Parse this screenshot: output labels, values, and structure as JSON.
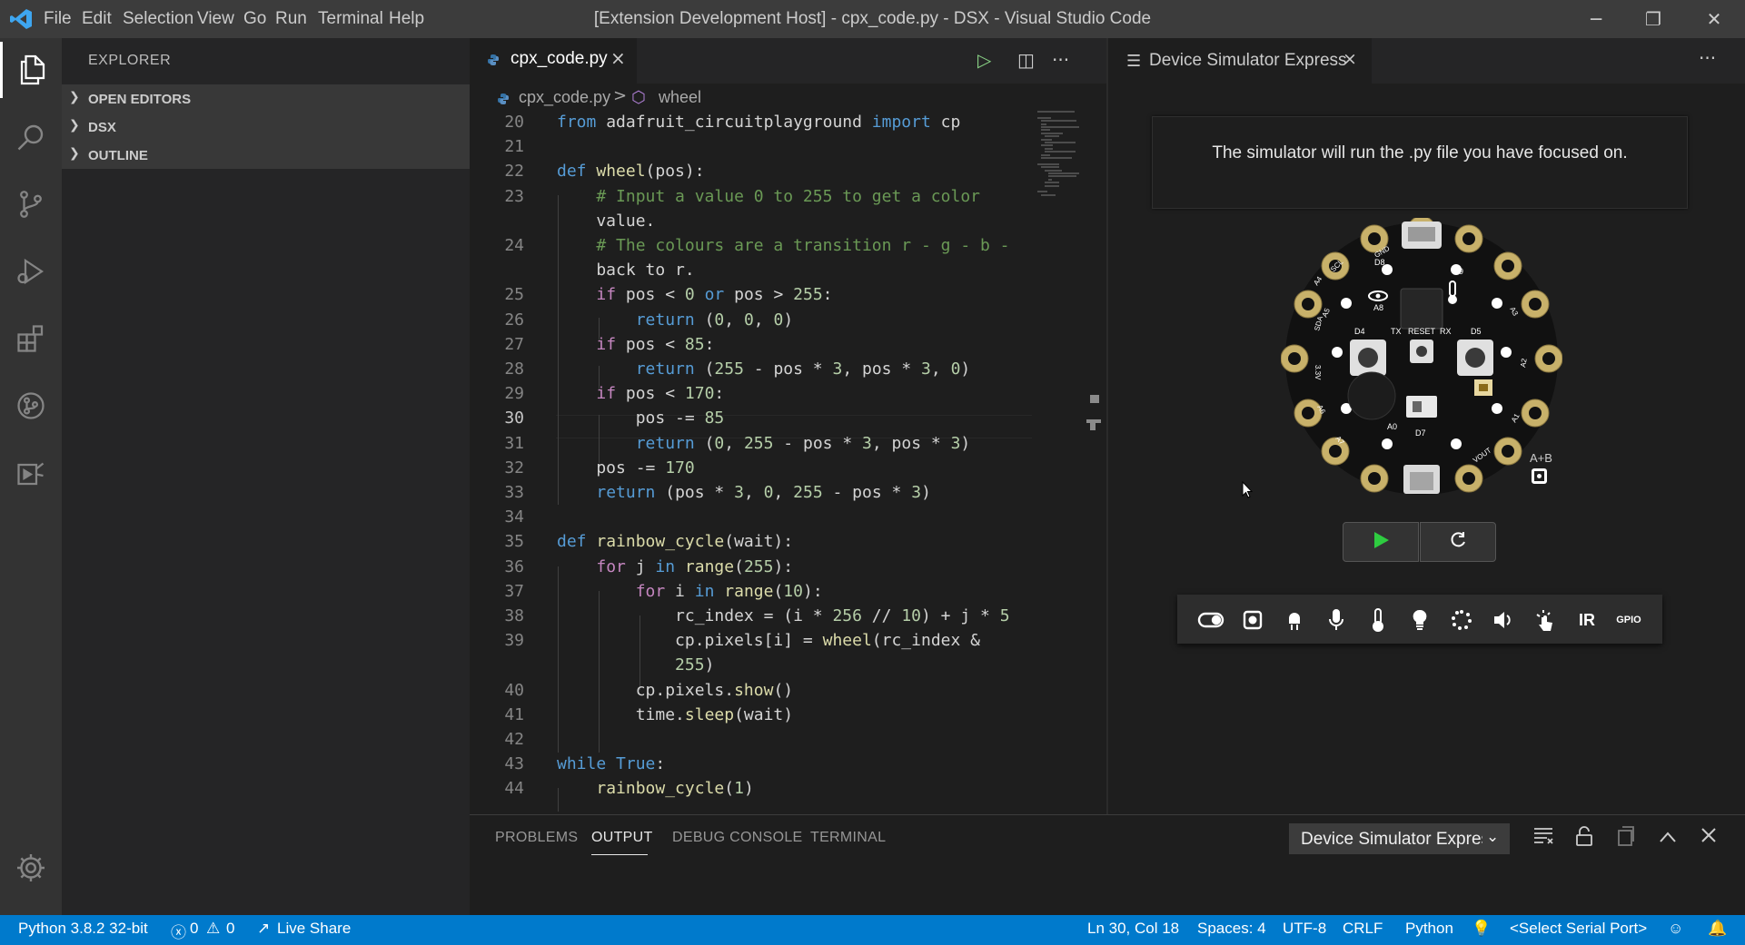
{
  "window": {
    "title": "[Extension Development Host] - cpx_code.py - DSX - Visual Studio Code",
    "logo": "vscode-logo",
    "controls": {
      "minimize": "─",
      "restore": "❐",
      "close": "✕"
    }
  },
  "menu": [
    "File",
    "Edit",
    "Selection",
    "View",
    "Go",
    "Run",
    "Terminal",
    "Help"
  ],
  "activity_bar": [
    "explorer-icon",
    "search-icon",
    "source-control-icon",
    "run-debug-icon",
    "extensions-icon",
    "git-graph-icon",
    "device-simulator-icon",
    "settings-gear-icon"
  ],
  "sidebar": {
    "title": "EXPLORER",
    "sections": [
      "OPEN EDITORS",
      "DSX",
      "OUTLINE"
    ]
  },
  "editor": {
    "tab_label": "cpx_code.py",
    "tab_close": "×",
    "actions": {
      "run": "▷",
      "split": "◫",
      "more": "···"
    },
    "breadcrumb": {
      "file": "cpx_code.py",
      "separator": ">",
      "symbol_icon": "⬡",
      "symbol": "wheel"
    },
    "current_line": 30,
    "lines": [
      {
        "n": "20",
        "code": "from adafruit_circuitplayground import cp"
      },
      {
        "n": "21",
        "code": ""
      },
      {
        "n": "22",
        "code": "def wheel(pos):"
      },
      {
        "n": "23",
        "code": "    # Input a value 0 to 255 to get a color"
      },
      {
        "n": "",
        "code": "    value."
      },
      {
        "n": "24",
        "code": "    # The colours are a transition r - g - b -"
      },
      {
        "n": "",
        "code": "    back to r."
      },
      {
        "n": "25",
        "code": "    if pos < 0 or pos > 255:"
      },
      {
        "n": "26",
        "code": "        return (0, 0, 0)"
      },
      {
        "n": "27",
        "code": "    if pos < 85:"
      },
      {
        "n": "28",
        "code": "        return (255 - pos * 3, pos * 3, 0)"
      },
      {
        "n": "29",
        "code": "    if pos < 170:"
      },
      {
        "n": "30",
        "code": "        pos -= 85"
      },
      {
        "n": "31",
        "code": "        return (0, 255 - pos * 3, pos * 3)"
      },
      {
        "n": "32",
        "code": "    pos -= 170"
      },
      {
        "n": "33",
        "code": "    return (pos * 3, 0, 255 - pos * 3)"
      },
      {
        "n": "34",
        "code": ""
      },
      {
        "n": "35",
        "code": "def rainbow_cycle(wait):"
      },
      {
        "n": "36",
        "code": "    for j in range(255):"
      },
      {
        "n": "37",
        "code": "        for i in range(10):"
      },
      {
        "n": "38",
        "code": "            rc_index = (i * 256 // 10) + j * 5"
      },
      {
        "n": "39",
        "code": "            cp.pixels[i] = wheel(rc_index &"
      },
      {
        "n": "",
        "code": "            255)"
      },
      {
        "n": "40",
        "code": "        cp.pixels.show()"
      },
      {
        "n": "41",
        "code": "        time.sleep(wait)"
      },
      {
        "n": "42",
        "code": ""
      },
      {
        "n": "43",
        "code": "while True:"
      },
      {
        "n": "44",
        "code": "    rainbow_cycle(1)"
      }
    ]
  },
  "simulator": {
    "tab_label": "Device Simulator Express",
    "tab_icon": "preview-icon",
    "tab_close": "×",
    "more": "···",
    "notice": "The simulator will run the .py file you have focused on.",
    "board_labels": {
      "top_left": "D8",
      "eye": "A8",
      "d4": "D4",
      "tx": "TX",
      "reset": "RESET",
      "rx": "RX",
      "d5": "D5",
      "d7": "D7",
      "a0": "A0",
      "a9": "A9",
      "gnd": "GND",
      "vout": "VOUT",
      "a1": "A1",
      "a2": "A2",
      "a3": "A3",
      "a4": "A4",
      "a5": "A5",
      "a6": "A6",
      "a7": "A7",
      "v33": "3.3V",
      "scl": "SCL",
      "sda": "SDA"
    },
    "ab_label": "A+B",
    "controls": [
      "play-icon",
      "refresh-icon"
    ],
    "sensors": [
      {
        "icon": "toggle-switch-icon",
        "label": ""
      },
      {
        "icon": "push-button-icon",
        "label": ""
      },
      {
        "icon": "neopixel-icon",
        "label": ""
      },
      {
        "icon": "microphone-icon",
        "label": ""
      },
      {
        "icon": "thermometer-icon",
        "label": ""
      },
      {
        "icon": "light-bulb-icon",
        "label": ""
      },
      {
        "icon": "shake-icon",
        "label": ""
      },
      {
        "icon": "speaker-icon",
        "label": ""
      },
      {
        "icon": "touch-icon",
        "label": ""
      },
      {
        "icon": "ir-icon",
        "label": "IR"
      },
      {
        "icon": "gpio-icon",
        "label": "GPIO"
      }
    ]
  },
  "panel": {
    "tabs": [
      "PROBLEMS",
      "OUTPUT",
      "DEBUG CONSOLE",
      "TERMINAL"
    ],
    "active_tab": "OUTPUT",
    "output_channel": "Device Simulator Express",
    "actions": [
      "clear-output-icon",
      "lock-scroll-icon",
      "open-editor-icon",
      "maximize-panel-icon",
      "close-panel-icon"
    ]
  },
  "status_bar": {
    "python": "Python 3.8.2 32-bit",
    "errors": "0",
    "warnings": "0",
    "live_share": "Live Share",
    "position": "Ln 30, Col 18",
    "spaces": "Spaces: 4",
    "encoding": "UTF-8",
    "eol": "CRLF",
    "language": "Python",
    "serial_port": "<Select Serial Port>"
  },
  "colors": {
    "accent": "#007acc",
    "title_bar": "#3c3c3c",
    "activity_bar": "#333333",
    "sidebar": "#252526",
    "editor": "#1e1e1e",
    "keyword": "#569cd6",
    "control_keyword": "#c586c0",
    "function": "#dcdcaa",
    "comment": "#6a9955",
    "number": "#b5cea8",
    "play_green": "#2ecc40"
  }
}
